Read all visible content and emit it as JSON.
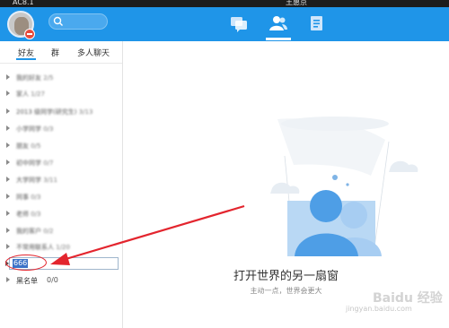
{
  "window": {
    "top_strip_left": "AC8.1",
    "top_strip_right": "王惠京"
  },
  "header": {
    "tabs": [
      {
        "icon": "chat-bubbles-icon",
        "active": false
      },
      {
        "icon": "contacts-icon",
        "active": true
      },
      {
        "icon": "apps-doc-icon",
        "active": false
      }
    ],
    "accent_color": "#1f95e8"
  },
  "sidebar": {
    "tabs": [
      "好友",
      "群",
      "多人聊天"
    ],
    "groups": [
      {
        "name": "我的好友 ",
        "count": "2/5"
      },
      {
        "name": "家人 ",
        "count": "1/27"
      },
      {
        "name": "2013 级同学(研究生) ",
        "count": "3/13"
      },
      {
        "name": "小学同学 ",
        "count": "0/3"
      },
      {
        "name": "朋友 ",
        "count": "0/5"
      },
      {
        "name": "初中同学 ",
        "count": "0/7"
      },
      {
        "name": "大学同学 ",
        "count": "3/11"
      },
      {
        "name": "同事 ",
        "count": "0/3"
      },
      {
        "name": "老师 ",
        "count": "0/3"
      },
      {
        "name": "我的客户 ",
        "count": "0/2"
      },
      {
        "name": "不常用联系人 ",
        "count": "1/20"
      }
    ],
    "editing_group_value": "666",
    "blacklist": {
      "name": "黑名单",
      "count": "0/0"
    }
  },
  "main": {
    "slogan": "打开世界的另一扇窗",
    "subslogan": "主动一点，世界会更大"
  },
  "watermark": {
    "logo": "Baidu 经验",
    "url": "jingyan.baidu.com"
  }
}
